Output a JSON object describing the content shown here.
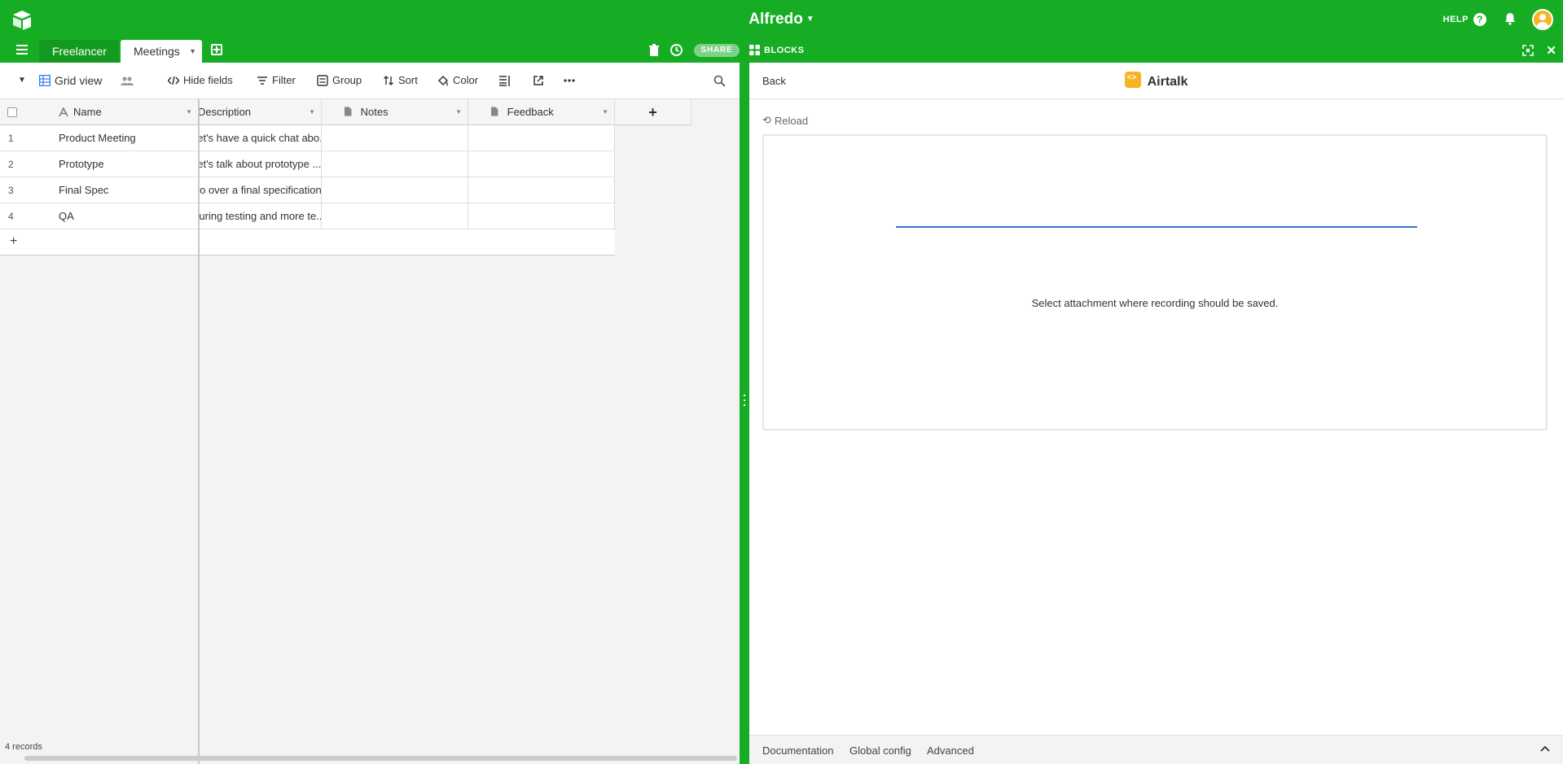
{
  "header": {
    "base_name": "Alfredo",
    "help_label": "HELP"
  },
  "tabs": [
    {
      "label": "Freelancer",
      "active": false
    },
    {
      "label": "Meetings",
      "active": true
    }
  ],
  "toolbar": {
    "share_label": "SHARE"
  },
  "view": {
    "name": "Grid view",
    "buttons": {
      "hide_fields": "Hide fields",
      "filter": "Filter",
      "group": "Group",
      "sort": "Sort",
      "color": "Color"
    }
  },
  "grid": {
    "columns": [
      "Name",
      "Description",
      "Notes",
      "Feedback"
    ],
    "rows": [
      {
        "num": "1",
        "name": "Product Meeting",
        "description": "Let's have a quick chat abo...",
        "notes": "",
        "feedback": ""
      },
      {
        "num": "2",
        "name": "Prototype",
        "description": "Let's talk about prototype ...",
        "notes": "",
        "feedback": ""
      },
      {
        "num": "3",
        "name": "Final Spec",
        "description": "Go over a final specification ...",
        "notes": "",
        "feedback": ""
      },
      {
        "num": "4",
        "name": "QA",
        "description": "During testing and more te...",
        "notes": "",
        "feedback": ""
      }
    ],
    "record_count": "4 records"
  },
  "blocks": {
    "panel_label": "BLOCKS",
    "back_label": "Back",
    "block_name": "Airtalk",
    "reload_label": "Reload",
    "message": "Select attachment where recording should be saved.",
    "footer_links": [
      "Documentation",
      "Global config",
      "Advanced"
    ]
  },
  "colors": {
    "brand_green": "#16ad24",
    "accent_yellow": "#f8b322",
    "progress_blue": "#2b7bd0"
  },
  "icons": [
    "airtable-logo-icon",
    "help-icon",
    "bell-icon",
    "avatar-icon",
    "hamburger-icon",
    "add-table-icon",
    "trash-icon",
    "history-icon",
    "grid-view-icon",
    "collaborators-icon",
    "hide-fields-icon",
    "filter-icon",
    "group-icon",
    "sort-icon",
    "color-icon",
    "row-height-icon",
    "share-view-icon",
    "more-icon",
    "search-icon",
    "blocks-icon",
    "fullscreen-icon",
    "close-icon",
    "reload-icon",
    "chevron-up-icon"
  ]
}
